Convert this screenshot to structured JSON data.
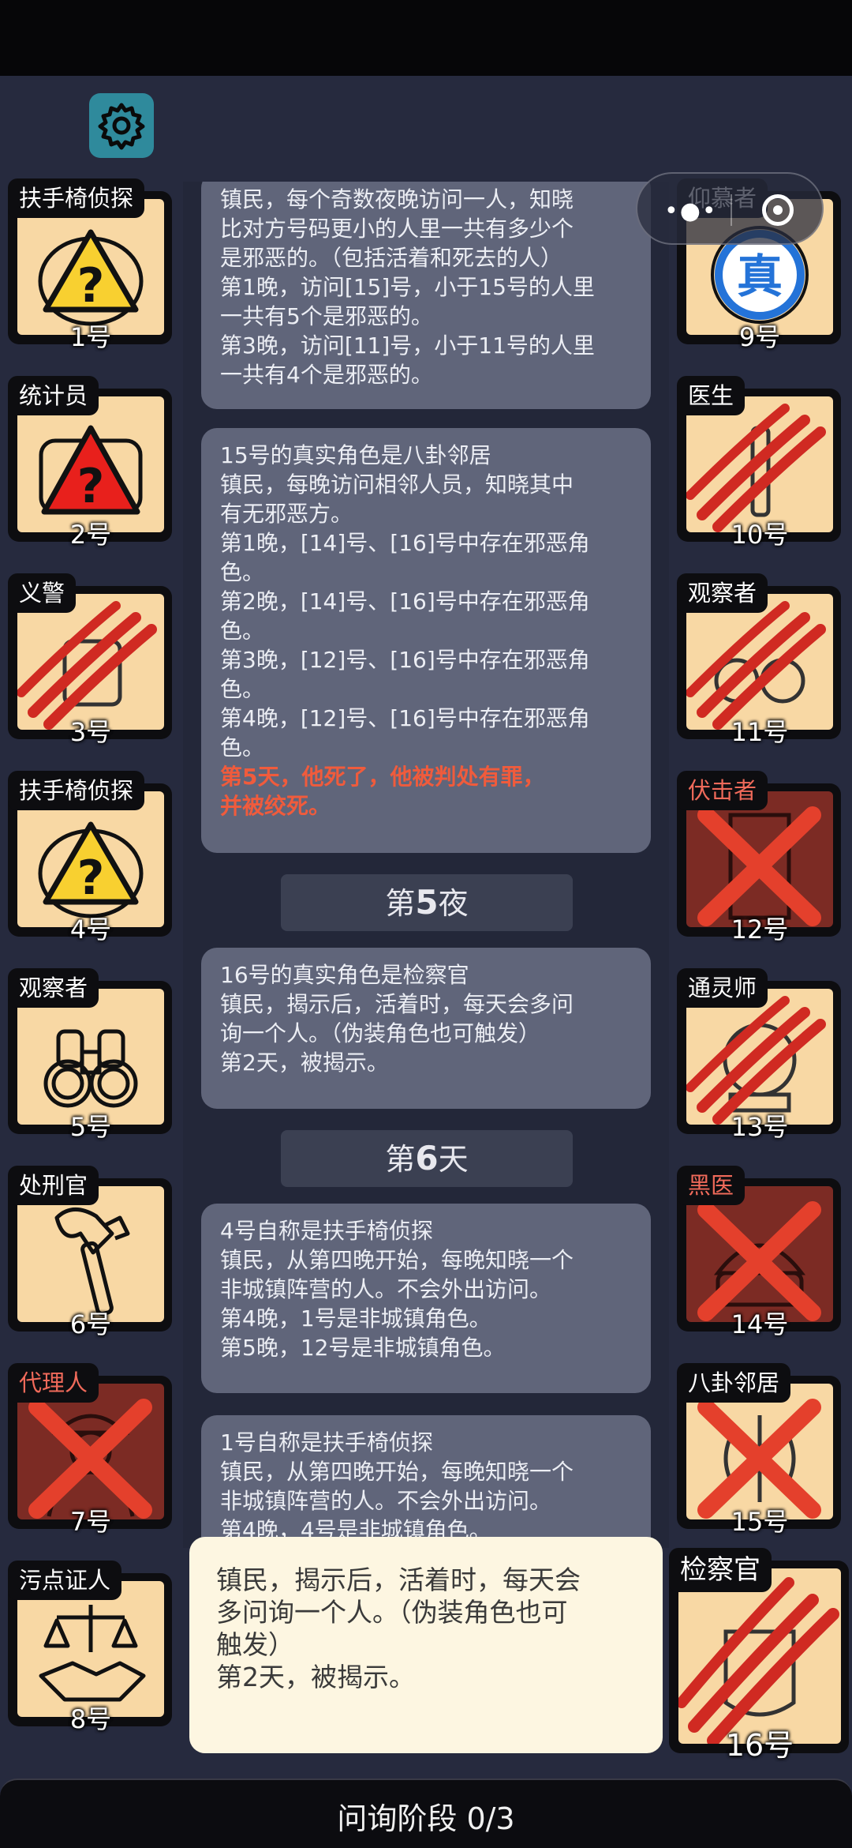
{
  "feed": {
    "msg1": "镇民，每个奇数夜晚访问一人，知晓\n比对方号码更小的人里一共有多少个\n是邪恶的。（包括活着和死去的人）\n第1晚，访问[15]号，小于15号的人里\n一共有5个是邪恶的。\n第3晚，访问[11]号，小于11号的人里\n一共有4个是邪恶的。",
    "msg2": "15号的真实角色是八卦邻居\n镇民，每晚访问相邻人员，知晓其中\n有无邪恶方。\n第1晚，[14]号、[16]号中存在邪恶角\n色。\n第2晚，[14]号、[16]号中存在邪恶角\n色。\n第3晚，[12]号、[16]号中存在邪恶角\n色。\n第4晚，[12]号、[16]号中存在邪恶角\n色。",
    "msg2_red": "第5天，他死了，他被判处有罪，\n并被绞死。",
    "sep1_pre": "第",
    "sep1_num": "5",
    "sep1_post": "夜",
    "msg3": "16号的真实角色是检察官\n镇民，揭示后，活着时，每天会多问\n询一个人。（伪装角色也可触发）\n第2天，被揭示。",
    "sep2_pre": "第",
    "sep2_num": "6",
    "sep2_post": "天",
    "msg4": "4号自称是扶手椅侦探\n镇民，从第四晚开始，每晚知晓一个\n非城镇阵营的人。不会外出访问。\n第4晚，1号是非城镇角色。\n第5晚，12号是非城镇角色。",
    "msg5": "1号自称是扶手椅侦探\n镇民，从第四晚开始，每晚知晓一个\n非城镇阵营的人。不会外出访问。\n第4晚，4号是非城镇角色。"
  },
  "players": [
    {
      "role": "扶手椅侦探",
      "num": "1号",
      "icon": "warning-question-icon",
      "state": "alive"
    },
    {
      "role": "统计员",
      "num": "2号",
      "icon": "warning-question-red-icon",
      "state": "alive"
    },
    {
      "role": "义警",
      "num": "3号",
      "icon": "scratched-icon",
      "state": "attacked"
    },
    {
      "role": "扶手椅侦探",
      "num": "4号",
      "icon": "warning-question-icon",
      "state": "alive"
    },
    {
      "role": "观察者",
      "num": "5号",
      "icon": "binoculars-icon",
      "state": "alive"
    },
    {
      "role": "处刑官",
      "num": "6号",
      "icon": "axe-icon",
      "state": "alive"
    },
    {
      "role": "代理人",
      "num": "7号",
      "icon": "agent-icon",
      "state": "dead"
    },
    {
      "role": "污点证人",
      "num": "8号",
      "icon": "scales-handshake-icon",
      "state": "alive"
    },
    {
      "role": "仰慕者",
      "num": "9号",
      "icon": "true-badge-icon",
      "state": "alive"
    },
    {
      "role": "医生",
      "num": "10号",
      "icon": "scratched-icon",
      "state": "attacked"
    },
    {
      "role": "观察者",
      "num": "11号",
      "icon": "scratched-icon",
      "state": "attacked"
    },
    {
      "role": "伏击者",
      "num": "12号",
      "icon": "door-icon",
      "state": "dead"
    },
    {
      "role": "通灵师",
      "num": "13号",
      "icon": "scratched-icon",
      "state": "attacked"
    },
    {
      "role": "黑医",
      "num": "14号",
      "icon": "dark-doctor-icon",
      "state": "dead"
    },
    {
      "role": "八卦邻居",
      "num": "15号",
      "icon": "neighbor-icon",
      "state": "dead"
    },
    {
      "role": "检察官",
      "num": "16号",
      "icon": "scratched-icon",
      "state": "attacked"
    }
  ],
  "capsule_icon": "more-and-close-icon",
  "settings_icon": "gear-icon",
  "popup": "镇民，揭示后，活着时，每天会\n多问询一个人。（伪装角色也可\n触发）\n第2天，被揭示。",
  "phase": "问询阶段 0/3",
  "colors": {
    "accent_red": "#f05b3c",
    "card": "#f8d8a4",
    "dead_card": "#7c2b24",
    "bg": "#262a3e"
  }
}
